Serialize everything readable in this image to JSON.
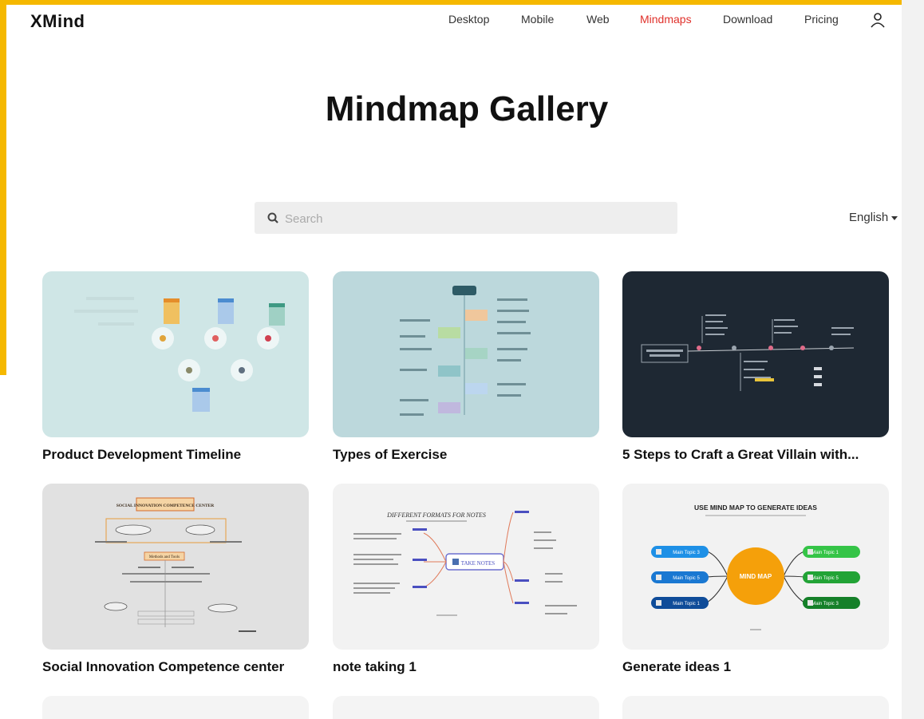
{
  "header": {
    "logo": "XMind",
    "nav": [
      "Desktop",
      "Mobile",
      "Web",
      "Mindmaps",
      "Download",
      "Pricing"
    ],
    "active_nav": "Mindmaps",
    "accent_color": "#f5b800",
    "active_color": "#e0312b"
  },
  "hero": {
    "title": "Mindmap Gallery"
  },
  "search": {
    "placeholder": "Search"
  },
  "language": {
    "selected": "English"
  },
  "cards": [
    {
      "title": "Product Development Timeline",
      "thumb_bg": "#cfe6e6"
    },
    {
      "title": "Types of Exercise",
      "thumb_bg": "#bcd8dc"
    },
    {
      "title": "5 Steps to Craft a Great Villain with...",
      "thumb_bg": "#1e2833"
    },
    {
      "title": "Social Innovation Competence center",
      "thumb_bg": "#e1e1e1"
    },
    {
      "title": "note taking 1",
      "thumb_bg": "#f2f2f2"
    },
    {
      "title": "Generate ideas 1",
      "thumb_bg": "#f2f2f2"
    }
  ],
  "thumb_texts": {
    "gen_heading": "USE MIND MAP TO GENERATE IDEAS",
    "gen_center": "MIND MAP",
    "gen_left": [
      "Main Topic 3",
      "Main Topic 5",
      "Main Topic 1"
    ],
    "gen_right": [
      "Main Topic 1",
      "Main Topic 5",
      "Main Topic 3"
    ],
    "note_heading": "DIFFERENT FORMATS FOR NOTES",
    "note_center": "TAKE NOTES",
    "social_heading": "SOCIAL INNOVATION COMPETENCE CENTER",
    "social_sub": "Methods and Tools"
  }
}
